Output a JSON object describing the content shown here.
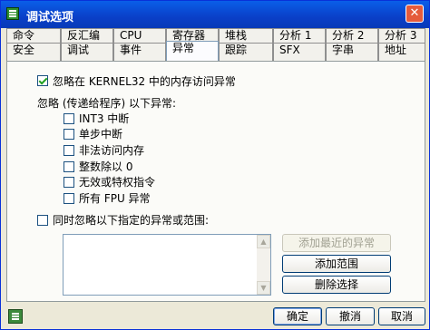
{
  "window": {
    "title": "调试选项",
    "close_glyph": "✕"
  },
  "tabs": {
    "row_back": [
      "命令",
      "反汇编",
      "CPU",
      "寄存器",
      "堆栈",
      "分析 1",
      "分析 2",
      "分析 3"
    ],
    "row_front": [
      "安全",
      "调试",
      "事件",
      "异常",
      "跟踪",
      "SFX",
      "字串",
      "地址"
    ],
    "active": "异常"
  },
  "exceptions": {
    "ignore_kernel32": {
      "label": "忽略在 KERNEL32 中的内存访问异常",
      "checked": true
    },
    "group_label": "忽略 (传递给程序) 以下异常:",
    "items": [
      {
        "label": "INT3 中断",
        "checked": false
      },
      {
        "label": "单步中断",
        "checked": false
      },
      {
        "label": "非法访问内存",
        "checked": false
      },
      {
        "label": "整数除以 0",
        "checked": false
      },
      {
        "label": "无效或特权指令",
        "checked": false
      },
      {
        "label": "所有 FPU 异常",
        "checked": false
      }
    ],
    "ignore_custom": {
      "label": "同时忽略以下指定的异常或范围:",
      "checked": false
    },
    "buttons": {
      "add_last": "添加最近的异常",
      "add_range": "添加范围",
      "delete": "删除选择"
    }
  },
  "footer": {
    "ok": "确定",
    "cancel": "撤消",
    "cancel2": "取消"
  }
}
